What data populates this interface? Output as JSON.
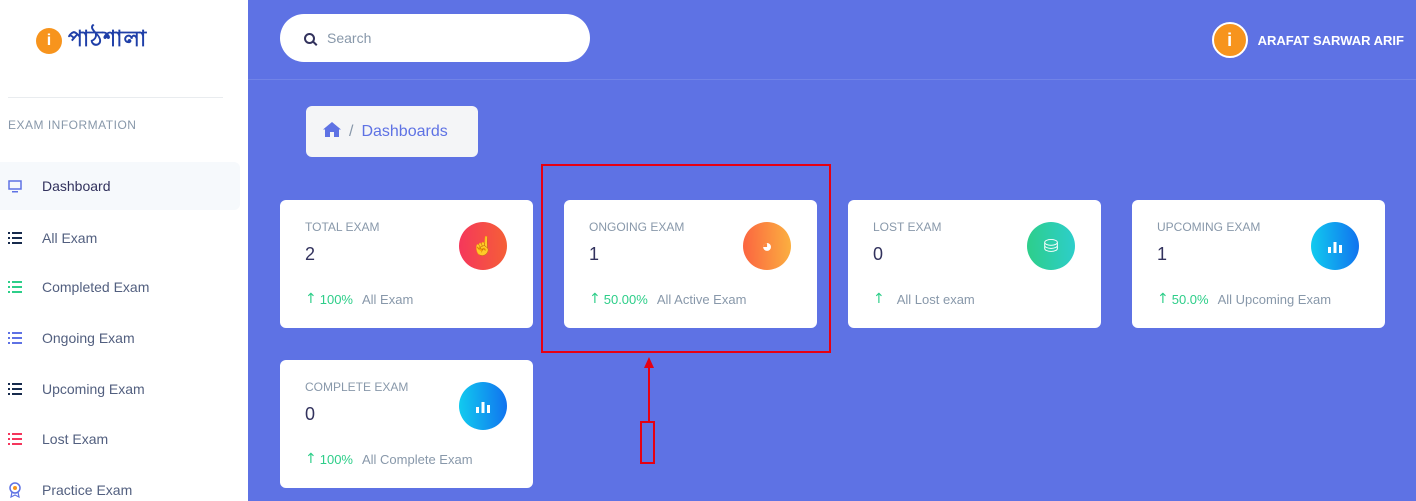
{
  "brand": {
    "logo_mark": "i",
    "logo_text": "পাঠশালা"
  },
  "sidebar": {
    "heading": "EXAM INFORMATION",
    "items": [
      {
        "label": "Dashboard",
        "icon": "monitor-icon",
        "color": "#5e72e4",
        "active": true
      },
      {
        "label": "All Exam",
        "icon": "list-icon",
        "color": "#172b4d"
      },
      {
        "label": "Completed Exam",
        "icon": "list-icon",
        "color": "#2dce89"
      },
      {
        "label": "Ongoing Exam",
        "icon": "list-icon",
        "color": "#5e72e4"
      },
      {
        "label": "Upcoming Exam",
        "icon": "list-icon",
        "color": "#172b4d"
      },
      {
        "label": "Lost Exam",
        "icon": "list-icon",
        "color": "#f5365c"
      },
      {
        "label": "Practice Exam",
        "icon": "award-icon",
        "color": "#5e72e4"
      }
    ]
  },
  "header": {
    "search_placeholder": "Search",
    "user": {
      "avatar_letter": "i",
      "name": "ARAFAT SARWAR ARIF"
    }
  },
  "breadcrumb": {
    "separator": "/",
    "current": "Dashboards"
  },
  "cards": [
    {
      "title": "TOTAL EXAM",
      "value": "2",
      "change": "100%",
      "footer": "All Exam",
      "icon": "hand-pointer-icon",
      "glyph": "☝"
    },
    {
      "title": "ONGOING EXAM",
      "value": "1",
      "change": "50.00%",
      "footer": "All Active Exam",
      "icon": "pie-chart-icon",
      "glyph": "◕"
    },
    {
      "title": "LOST EXAM",
      "value": "0",
      "change": "",
      "footer": "All Lost exam",
      "icon": "money-icon",
      "glyph": "⛁"
    },
    {
      "title": "UPCOMING EXAM",
      "value": "1",
      "change": "50.0%",
      "footer": "All Upcoming Exam",
      "icon": "bar-chart-icon",
      "glyph": "▐▌"
    },
    {
      "title": "COMPLETE EXAM",
      "value": "0",
      "change": "100%",
      "footer": "All Complete Exam",
      "icon": "bar-chart-icon",
      "glyph": "▐▌"
    }
  ],
  "arrow_glyph": "↑",
  "colors": {
    "primary": "#5e72e4",
    "success": "#2dce89",
    "annotation": "#e60012",
    "brand_orange": "#f7941d"
  }
}
